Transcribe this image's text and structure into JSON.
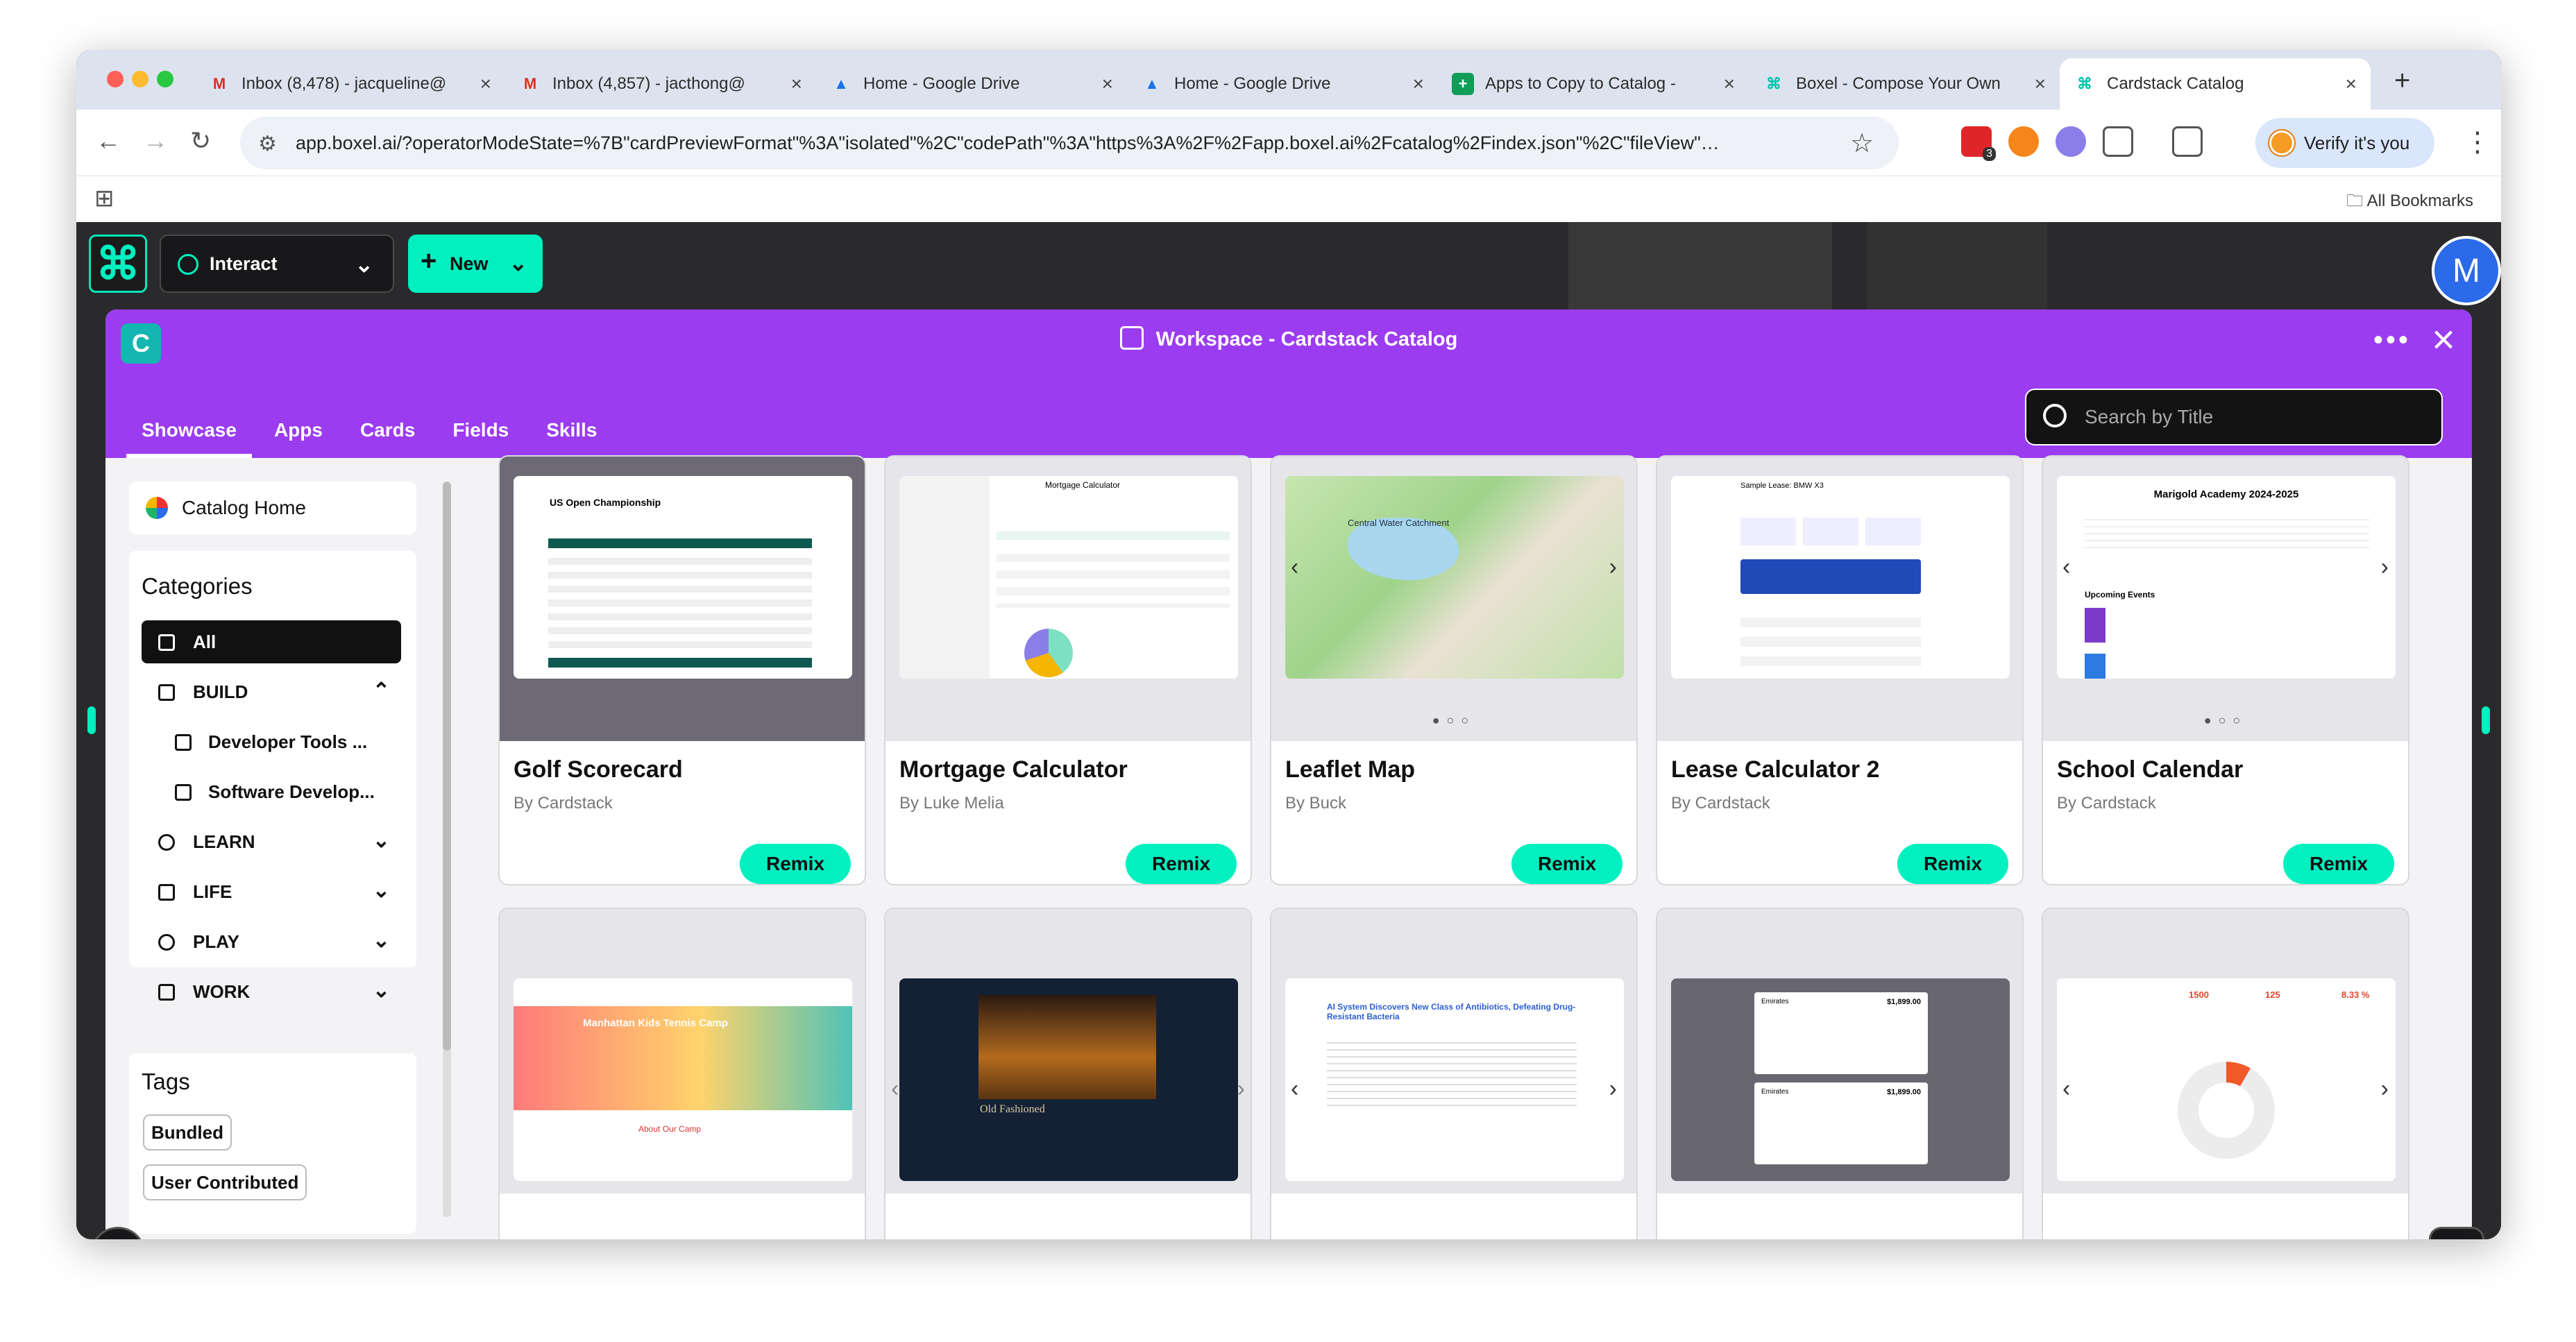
{
  "browser": {
    "tabs": [
      {
        "title": "Inbox (8,478) - jacqueline@",
        "icon": "M",
        "icon_color": "#d93025"
      },
      {
        "title": "Inbox (4,857) - jacthong@",
        "icon": "M",
        "icon_color": "#d93025"
      },
      {
        "title": "Home - Google Drive",
        "icon": "▲",
        "icon_color": "#1a73e8"
      },
      {
        "title": "Home - Google Drive",
        "icon": "▲",
        "icon_color": "#1a73e8"
      },
      {
        "title": "Apps to Copy to Catalog -",
        "icon": "+",
        "icon_color": "#0f9d58"
      },
      {
        "title": "Boxel - Compose Your Own",
        "icon": "⌘",
        "icon_color": "#00c4b0"
      },
      {
        "title": "Cardstack Catalog",
        "icon": "⌘",
        "icon_color": "#00c4b0"
      }
    ],
    "url": "app.boxel.ai/?operatorModeState=%7B\"cardPreviewFormat\"%3A\"isolated\"%2C\"codePath\"%3A\"https%3A%2F%2Fapp.boxel.ai%2Fcatalog%2Findex.json\"%2C\"fileView\"…",
    "verify_label": "Verify it's you",
    "bookmarks_label": "All Bookmarks",
    "ext_badge": "3"
  },
  "app": {
    "mode_label": "Interact",
    "new_label": "New",
    "avatar_letter": "M",
    "accent": "#00f0c0"
  },
  "panel": {
    "card_letter": "C",
    "title": "Workspace - Cardstack Catalog",
    "tabs": [
      "Showcase",
      "Apps",
      "Cards",
      "Fields",
      "Skills"
    ],
    "search_placeholder": "Search by Title",
    "header_color": "#9b3cf0"
  },
  "sidebar": {
    "home_label": "Catalog Home",
    "categories_heading": "Categories",
    "categories": [
      {
        "label": "All"
      },
      {
        "label": "BUILD"
      },
      {
        "label": "Developer Tools ..."
      },
      {
        "label": "Software Develop..."
      },
      {
        "label": "LEARN"
      },
      {
        "label": "LIFE"
      },
      {
        "label": "PLAY"
      },
      {
        "label": "WORK"
      }
    ],
    "tags_heading": "Tags",
    "tags": [
      "Bundled",
      "User Contributed"
    ]
  },
  "cards": [
    {
      "title": "Golf Scorecard",
      "by": "By Cardstack",
      "remix": "Remix"
    },
    {
      "title": "Mortgage Calculator",
      "by": "By Luke Melia",
      "remix": "Remix"
    },
    {
      "title": "Leaflet Map",
      "by": "By Buck",
      "remix": "Remix"
    },
    {
      "title": "Lease Calculator 2",
      "by": "By Cardstack",
      "remix": "Remix"
    },
    {
      "title": "School Calendar",
      "by": "By Cardstack",
      "remix": "Remix"
    }
  ],
  "thumbs": {
    "golf": "US Open Championship",
    "mortgage": "Mortgage Calculator",
    "leaflet": "Central Water Catchment",
    "lease": "Sample Lease: BMW X3",
    "school": "Marigold Academy 2024-2025",
    "school_sub": "Upcoming Events",
    "tennis": "Manhattan Kids Tennis Camp",
    "tennis_sub": "About Our Camp",
    "cocktail": "Old Fashioned",
    "news": "AI System Discovers New Class of Antibiotics, Defeating Drug-Resistant Bacteria",
    "flight_price": "$1,899.00",
    "flight_airline": "Emirates",
    "progress_target": "1500",
    "progress_value": "125",
    "progress_rate": "8.33 %"
  }
}
